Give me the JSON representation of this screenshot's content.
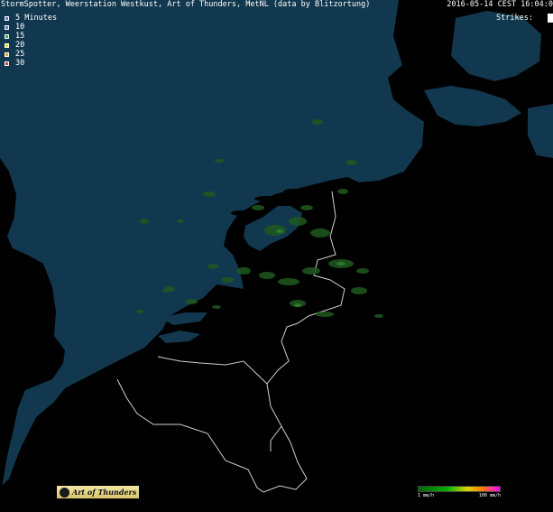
{
  "header": {
    "title": "StormSpotter, Weerstation Westkust, Art of Thunders, MetNL (data by Blitzortung)",
    "timestamp": "2016-05-14 CEST 16:04:0",
    "strikes_label": "Strikes:"
  },
  "legend": {
    "items": [
      {
        "label": "5 Minutes",
        "color": "#6a6aff"
      },
      {
        "label": "10",
        "color": "#5a78d8"
      },
      {
        "label": "15",
        "color": "#2fae5a"
      },
      {
        "label": "20",
        "color": "#e6e600"
      },
      {
        "label": "25",
        "color": "#e8a020"
      },
      {
        "label": "30",
        "color": "#ff3030"
      }
    ]
  },
  "logo": {
    "text": "Art of Thunders",
    "background": "#e6d78a"
  },
  "scale": {
    "min_label": "1 mm/h",
    "max_label": "100 mm/h"
  },
  "colors": {
    "sea": "#12384f",
    "land": "#000000",
    "border": "#cfcfcf",
    "precip_light": "#1f5a1f",
    "precip_medium": "#2d7a2d"
  }
}
